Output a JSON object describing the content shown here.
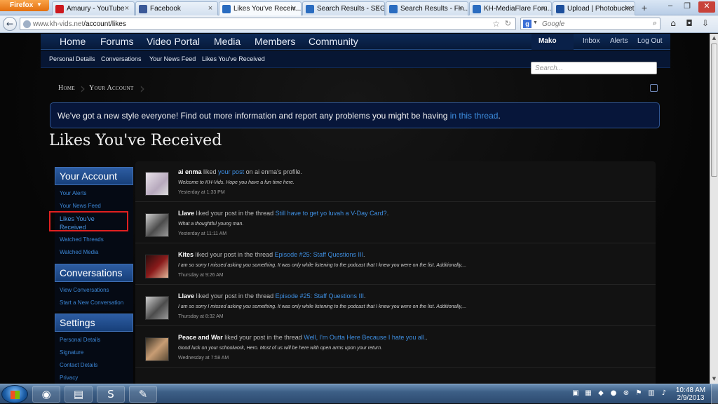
{
  "browser": {
    "app_button": "Firefox",
    "tabs": [
      {
        "label": "Amaury - YouTube",
        "icon": "youtube-icon",
        "color": "#cc181e"
      },
      {
        "label": "Facebook",
        "icon": "facebook-icon",
        "color": "#3b5998"
      },
      {
        "label": "Likes You've Receiv...",
        "icon": "khvids-icon",
        "color": "#2a6cc0",
        "active": true
      },
      {
        "label": "Search Results - SEG...",
        "icon": "khvids-icon",
        "color": "#2a6cc0"
      },
      {
        "label": "Search Results - Fin...",
        "icon": "khvids-icon",
        "color": "#2a6cc0"
      },
      {
        "label": "KH-MediaFlare Foru...",
        "icon": "khvids-icon",
        "color": "#2a6cc0"
      },
      {
        "label": "Upload | Photobucket",
        "icon": "photobucket-icon",
        "color": "#1d4f9c"
      }
    ],
    "url_host": "www.kh-vids.net",
    "url_path": "/account/likes",
    "search_engine": "Google",
    "search_placeholder": "Google"
  },
  "site": {
    "nav": [
      "Home",
      "Forums",
      "Video Portal",
      "Media",
      "Members",
      "Community"
    ],
    "user": {
      "name": "Mako",
      "links": [
        "Inbox",
        "Alerts",
        "Log Out"
      ]
    },
    "subnav": [
      "Personal Details",
      "Conversations",
      "Your News Feed",
      "Likes You've Received"
    ],
    "search_placeholder": "Search...",
    "breadcrumb": [
      "Home",
      "Your Account"
    ],
    "notice_text": "We've got a new style everyone! Find out more information and report any problems you might be having ",
    "notice_link": "in this thread",
    "notice_end": ".",
    "page_title": "Likes You've Received"
  },
  "sidebar": [
    {
      "title": "Your Account",
      "links": [
        "Your Alerts",
        "Your News Feed",
        "Likes You've Received",
        "Watched Threads",
        "Watched Media"
      ]
    },
    {
      "title": "Conversations",
      "links": [
        "View Conversations",
        "Start a New Conversation"
      ]
    },
    {
      "title": "Settings",
      "links": [
        "Personal Details",
        "Signature",
        "Contact Details",
        "Privacy"
      ]
    }
  ],
  "likes": [
    {
      "user": "ai enma",
      "verb": " liked ",
      "link": "your post",
      "suffix": " on ai enma's profile.",
      "snippet": "Welcome to KH-Vids. Hope you have a fun time here.",
      "time": "Yesterday at 1:33 PM"
    },
    {
      "user": "Llave",
      "verb": " liked your post in the thread ",
      "link": "Still have to get yo luvah a V-Day Card?",
      "suffix": ".",
      "snippet": "What a thoughtful young man.",
      "time": "Yesterday at 11:11 AM"
    },
    {
      "user": "Kites",
      "verb": " liked your post in the thread ",
      "link": "Episode #25: Staff Questions III",
      "suffix": ".",
      "snippet": "I am so sorry I missed asking you something. It was only while listening to the podcast that I knew you were on the list. Additionally,...",
      "time": "Thursday at 9:26 AM"
    },
    {
      "user": "Llave",
      "verb": " liked your post in the thread ",
      "link": "Episode #25: Staff Questions III",
      "suffix": ".",
      "snippet": "I am so sorry I missed asking you something. It was only while listening to the podcast that I knew you were on the list. Additionally,...",
      "time": "Thursday at 8:32 AM"
    },
    {
      "user": "Peace and War",
      "verb": " liked your post in the thread ",
      "link": "Well, I'm Outta Here Because I hate you all.",
      "suffix": ".",
      "snippet": "Good luck on your schoolwork, Hero. Most of us will be here with open arms upon your return.",
      "time": "Wednesday at 7:58 AM"
    }
  ],
  "taskbar": {
    "clock_time": "10:48 AM",
    "clock_date": "2/9/2013"
  }
}
